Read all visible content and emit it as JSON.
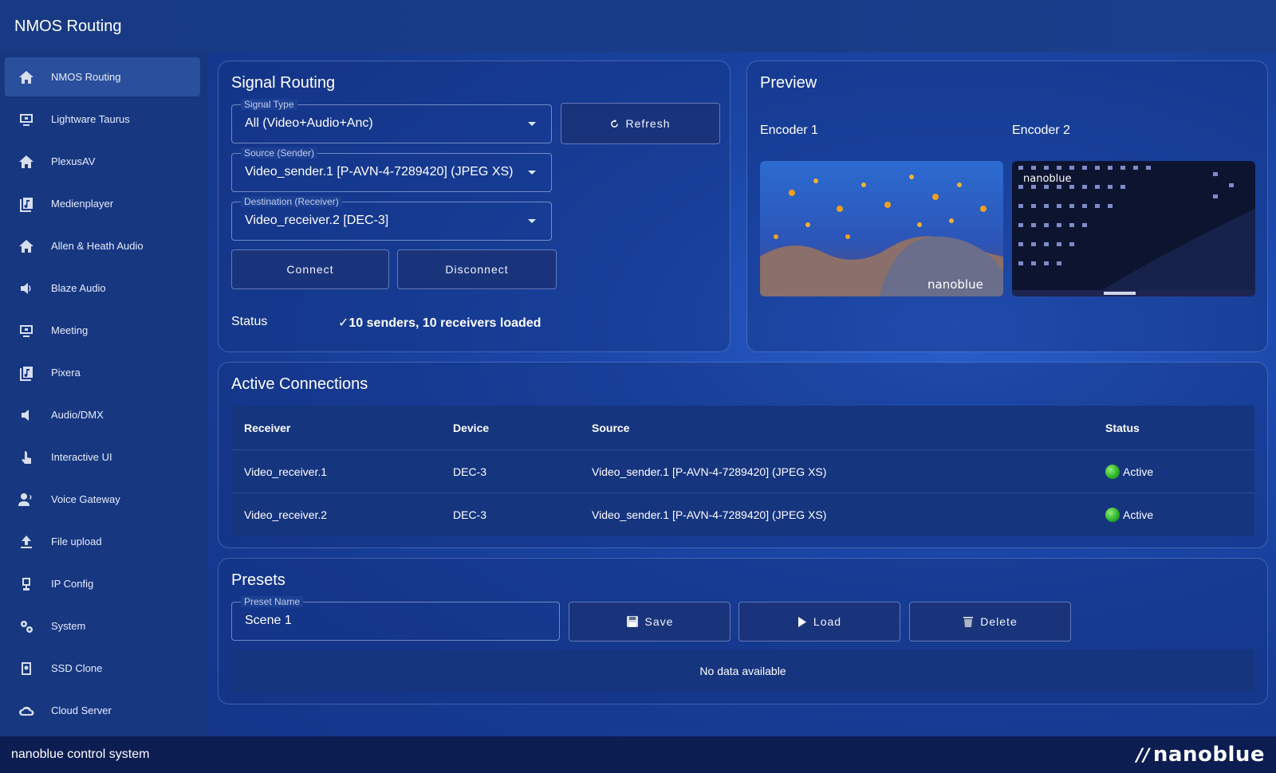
{
  "app": {
    "title": "NMOS Routing"
  },
  "sidebar": {
    "items": [
      {
        "label": "NMOS Routing",
        "icon": "home-icon",
        "active": true
      },
      {
        "label": "Lightware Taurus",
        "icon": "monitor-icon"
      },
      {
        "label": "PlexusAV",
        "icon": "home-icon"
      },
      {
        "label": "Medienplayer",
        "icon": "media-library-icon"
      },
      {
        "label": "Allen & Heath Audio",
        "icon": "home-icon"
      },
      {
        "label": "Blaze Audio",
        "icon": "volume-icon"
      },
      {
        "label": "Meeting",
        "icon": "monitor-icon"
      },
      {
        "label": "Pixera",
        "icon": "media-library-icon"
      },
      {
        "label": "Audio/DMX",
        "icon": "speaker-icon"
      },
      {
        "label": "Interactive UI",
        "icon": "touch-icon"
      },
      {
        "label": "Voice Gateway",
        "icon": "voice-icon"
      },
      {
        "label": "File upload",
        "icon": "upload-icon"
      },
      {
        "label": "IP Config",
        "icon": "network-icon"
      },
      {
        "label": "System",
        "icon": "gears-icon"
      },
      {
        "label": "SSD Clone",
        "icon": "disk-icon"
      },
      {
        "label": "Cloud Server",
        "icon": "cloud-icon"
      }
    ]
  },
  "signal_routing": {
    "title": "Signal Routing",
    "signal_type": {
      "label": "Signal Type",
      "value": "All (Video+Audio+Anc)"
    },
    "source": {
      "label": "Source (Sender)",
      "value": "Video_sender.1 [P-AVN-4-7289420] (JPEG XS)"
    },
    "destination": {
      "label": "Destination (Receiver)",
      "value": "Video_receiver.2 [DEC-3]"
    },
    "refresh_label": "Refresh",
    "connect_label": "Connect",
    "disconnect_label": "Disconnect",
    "status_label": "Status",
    "status_text": "✓10 senders, 10 receivers loaded"
  },
  "preview": {
    "title": "Preview",
    "encoders": [
      {
        "label": "Encoder 1",
        "watermark": "nanoblue"
      },
      {
        "label": "Encoder 2",
        "watermark": "nanoblue"
      }
    ]
  },
  "active_connections": {
    "title": "Active Connections",
    "columns": [
      "Receiver",
      "Device",
      "Source",
      "Status"
    ],
    "rows": [
      {
        "receiver": "Video_receiver.1",
        "device": "DEC-3",
        "source": "Video_sender.1 [P-AVN-4-7289420] (JPEG XS)",
        "status": "Active"
      },
      {
        "receiver": "Video_receiver.2",
        "device": "DEC-3",
        "source": "Video_sender.1 [P-AVN-4-7289420] (JPEG XS)",
        "status": "Active"
      }
    ],
    "status_color": "#2eb52a"
  },
  "presets": {
    "title": "Presets",
    "name_label": "Preset Name",
    "name_value": "Scene 1",
    "save_label": "Save",
    "load_label": "Load",
    "delete_label": "Delete",
    "empty_text": "No data available"
  },
  "footer": {
    "text": "nanoblue control system",
    "brand": "nanoblue"
  }
}
